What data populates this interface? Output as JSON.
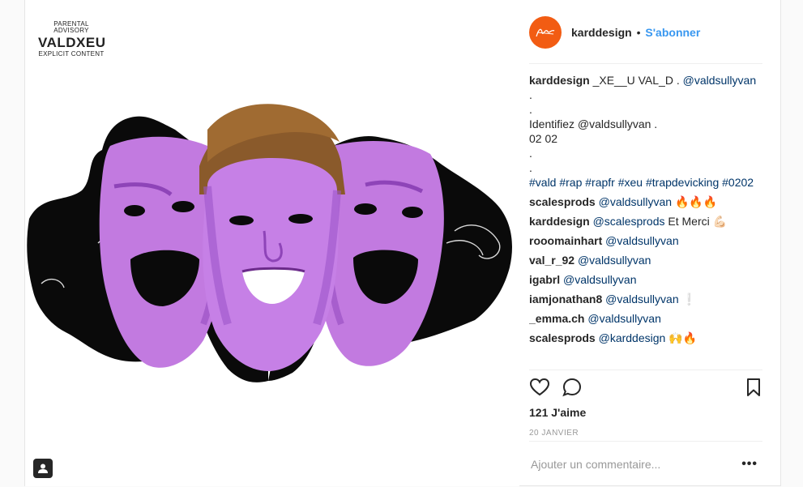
{
  "media": {
    "advisory_top": "PARENTAL ADVISORY",
    "advisory_main": "VALDXEU",
    "advisory_bottom": "EXPLICIT CONTENT"
  },
  "post": {
    "username": "karddesign",
    "separator": "•",
    "follow_label": "S'abonner",
    "caption_author": "karddesign",
    "caption_first_text": " _XE__U VAL_D . ",
    "caption_mention": "@valdsullyvan",
    "caption_lines": [
      ".",
      ".",
      "Identifiez @valdsullyvan .",
      "02 02",
      ".",
      "."
    ],
    "hashtags": "#vald #rap #rapfr #xeu #trapdevicking #0202",
    "comments": [
      {
        "author": "scalesprods",
        "mention": "@valdsullyvan",
        "text": " 🔥🔥🔥"
      },
      {
        "author": "karddesign",
        "mention": "@scalesprods",
        "text": " Et Merci 💪🏻"
      },
      {
        "author": "rooomainhart",
        "mention": "@valdsullyvan",
        "text": ""
      },
      {
        "author": "val_r_92",
        "mention": "@valdsullyvan",
        "text": ""
      },
      {
        "author": "igabrl",
        "mention": "@valdsullyvan",
        "text": ""
      },
      {
        "author": "iamjonathan8",
        "mention": "@valdsullyvan",
        "text": " ❕"
      },
      {
        "author": "_emma.ch",
        "mention": "@valdsullyvan",
        "text": ""
      },
      {
        "author": "scalesprods",
        "mention": "@karddesign",
        "text": " 🙌🔥"
      }
    ],
    "likes": "121 J'aime",
    "date": "20 JANVIER",
    "comment_placeholder": "Ajouter un commentaire...",
    "more_label": "•••"
  },
  "colors": {
    "accent": "#3897f0",
    "avatar_bg": "#f25c13",
    "mention": "#003569",
    "face_purple": "#b56ad6",
    "hair": "#8a5a2b"
  },
  "icons": [
    "heart-icon",
    "comment-icon",
    "bookmark-icon",
    "user-tag-icon",
    "more-options-icon"
  ]
}
